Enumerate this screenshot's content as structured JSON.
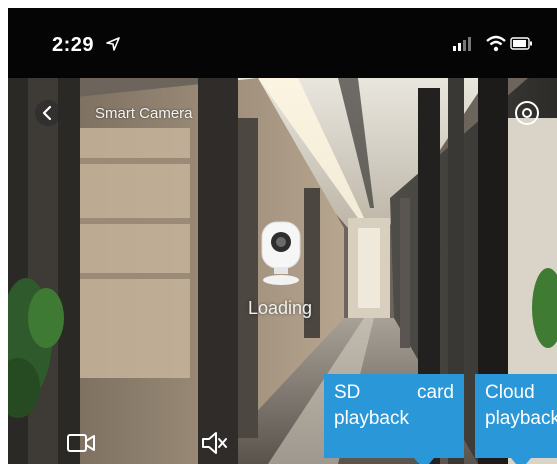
{
  "status_bar": {
    "time": "2:29",
    "location_icon": "location-arrow-icon",
    "signal_icon": "cellular-signal-icon",
    "wifi_icon": "wifi-icon",
    "battery_icon": "battery-icon"
  },
  "header": {
    "title": "Smart Camera",
    "back_icon": "chevron-left-icon",
    "settings_icon": "settings-icon"
  },
  "player": {
    "loading_text": "Loading",
    "loading_icon": "camera-icon"
  },
  "controls": {
    "record_icon": "video-record-icon",
    "speaker_icon": "speaker-muted-icon"
  },
  "tips": {
    "sd_word1": "SD",
    "sd_word2": "card",
    "sd_word3": "playback",
    "cloud_word1": "Cloud",
    "cloud_word2": "playback"
  },
  "colors": {
    "tip_background": "#2a98d8",
    "status_bar": "#050505"
  }
}
